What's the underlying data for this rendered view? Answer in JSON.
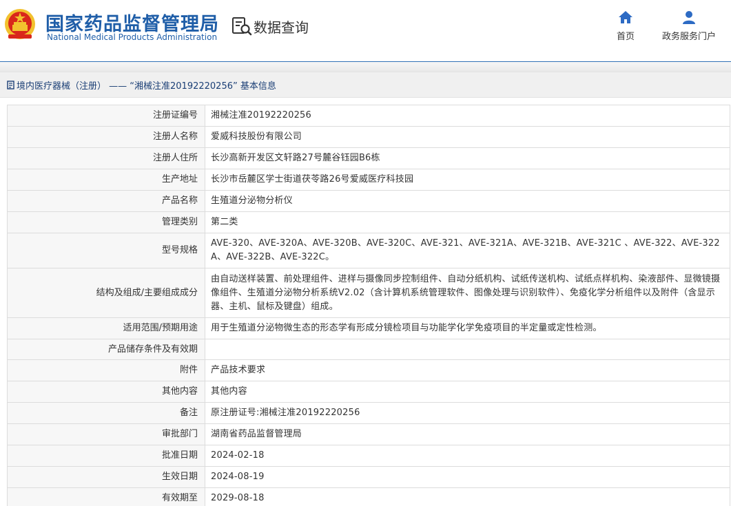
{
  "header": {
    "org_name_cn": "国家药品监督管理局",
    "org_name_en": "National Medical Products Administration",
    "query_label": "数据查询",
    "nav": [
      {
        "label": "首页",
        "icon": "home-icon"
      },
      {
        "label": "政务服务门户",
        "icon": "user-icon"
      }
    ]
  },
  "breadcrumb": {
    "icon": "document-icon",
    "text": "境内医疗器械（注册） —— “湘械注准20192220256” 基本信息"
  },
  "details": [
    {
      "label": "注册证编号",
      "value": "湘械注准20192220256"
    },
    {
      "label": "注册人名称",
      "value": "爱威科技股份有限公司"
    },
    {
      "label": "注册人住所",
      "value": "长沙高新开发区文轩路27号麓谷钰园B6栋"
    },
    {
      "label": "生产地址",
      "value": "长沙市岳麓区学士街道茯苓路26号爱威医疗科技园"
    },
    {
      "label": "产品名称",
      "value": "生殖道分泌物分析仪"
    },
    {
      "label": "管理类别",
      "value": "第二类"
    },
    {
      "label": "型号规格",
      "value": "AVE-320、AVE-320A、AVE-320B、AVE-320C、AVE-321、AVE-321A、AVE-321B、AVE-321C 、AVE-322、AVE-322A、AVE-322B、AVE-322C。"
    },
    {
      "label": "结构及组成/主要组成成分",
      "value": "由自动送样装置、前处理组件、进样与摄像同步控制组件、自动分纸机构、试纸传送机构、试纸点样机构、染液部件、显微镜摄像组件、生殖道分泌物分析系统V2.02（含计算机系统管理软件、图像处理与识别软件）、免疫化学分析组件以及附件（含显示器、主机、鼠标及键盘）组成。"
    },
    {
      "label": "适用范围/预期用途",
      "value": "用于生殖道分泌物微生态的形态学有形成分镜检项目与功能学化学免疫项目的半定量或定性检测。"
    },
    {
      "label": "产品储存条件及有效期",
      "value": ""
    },
    {
      "label": "附件",
      "value": "产品技术要求"
    },
    {
      "label": "其他内容",
      "value": "其他内容"
    },
    {
      "label": "备注",
      "value": "原注册证号:湘械注准20192220256"
    },
    {
      "label": "审批部门",
      "value": "湖南省药品监督管理局"
    },
    {
      "label": "批准日期",
      "value": "2024-02-18"
    },
    {
      "label": "生效日期",
      "value": "2024-08-19"
    },
    {
      "label": "有效期至",
      "value": "2029-08-18"
    }
  ],
  "colors": {
    "brand_blue": "#1f5ea8",
    "emblem_red": "#d9271b",
    "emblem_gold": "#f2c12e"
  }
}
